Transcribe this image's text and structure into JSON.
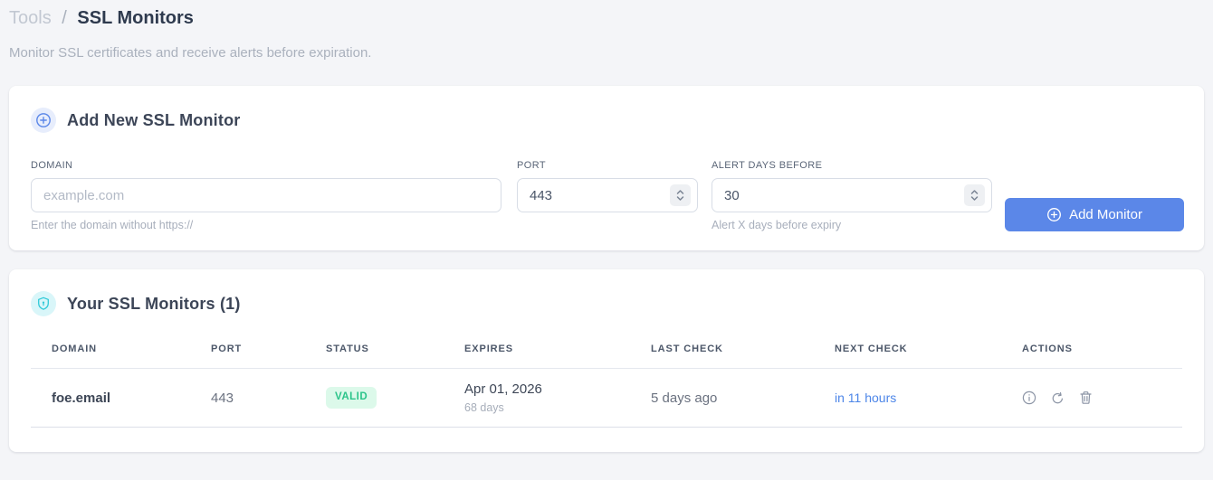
{
  "breadcrumb": {
    "root": "Tools",
    "separator": "/",
    "current": "SSL Monitors"
  },
  "subtitle": "Monitor SSL certificates and receive alerts before expiration.",
  "add_monitor": {
    "title": "Add New SSL Monitor",
    "fields": {
      "domain": {
        "label": "DOMAIN",
        "placeholder": "example.com",
        "helper": "Enter the domain without https://"
      },
      "port": {
        "label": "PORT",
        "value": "443"
      },
      "alert_days": {
        "label": "ALERT DAYS BEFORE",
        "value": "30",
        "helper": "Alert X days before expiry"
      }
    },
    "submit_label": "Add Monitor"
  },
  "monitors": {
    "title": "Your SSL Monitors (1)",
    "columns": [
      "DOMAIN",
      "PORT",
      "STATUS",
      "EXPIRES",
      "LAST CHECK",
      "NEXT CHECK",
      "ACTIONS"
    ],
    "rows": [
      {
        "domain": "foe.email",
        "port": "443",
        "status": "VALID",
        "expires_date": "Apr 01, 2026",
        "expires_days": "68 days",
        "last_check": "5 days ago",
        "next_check": "in 11 hours",
        "actions": [
          "info",
          "refresh",
          "delete"
        ]
      }
    ]
  },
  "colors": {
    "accent_blue": "#5b87e8",
    "link_blue": "#4d86e8",
    "valid_green": "#2bc48a",
    "valid_bg": "#dcf9ea",
    "header_icon_cyan": "#2fc9d8",
    "page_bg": "#f4f5f8"
  }
}
